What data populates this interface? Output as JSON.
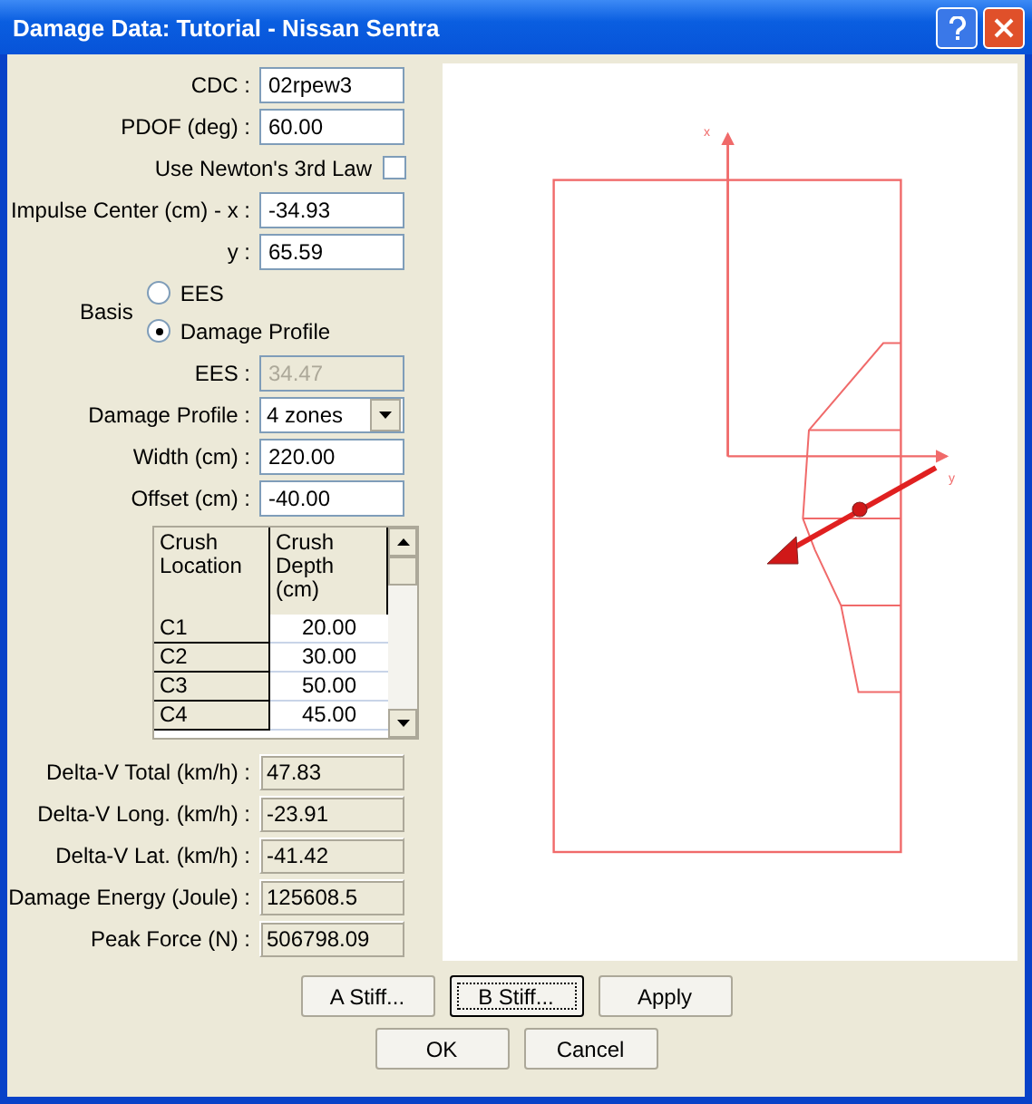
{
  "window": {
    "title": "Damage Data: Tutorial - Nissan Sentra"
  },
  "fields": [
    {
      "kind": "input",
      "label": "CDC :",
      "value": "02rpew3",
      "disabled": false
    },
    {
      "kind": "input",
      "label": "PDOF (deg) :",
      "value": "60.00",
      "disabled": false
    },
    {
      "kind": "checkbox",
      "label": "Use Newton's 3rd Law",
      "checked": false
    },
    {
      "kind": "input",
      "label": "Impulse Center (cm) - x :",
      "value": "-34.93",
      "disabled": false
    },
    {
      "kind": "input",
      "label": "y :",
      "value": "65.59",
      "disabled": false
    },
    {
      "kind": "radio",
      "label": "Basis",
      "options": [
        {
          "label": "EES",
          "selected": false
        },
        {
          "label": "Damage Profile",
          "selected": true
        }
      ]
    },
    {
      "kind": "input",
      "label": "EES :",
      "value": "34.47",
      "disabled": true
    },
    {
      "kind": "dropdown",
      "label": "Damage Profile :",
      "value": "4 zones"
    },
    {
      "kind": "input",
      "label": "Width (cm) :",
      "value": "220.00",
      "disabled": false
    },
    {
      "kind": "input",
      "label": "Offset (cm) :",
      "value": "-40.00",
      "disabled": false
    },
    {
      "kind": "table",
      "columns": [
        "Crush Location",
        "Crush Depth (cm)"
      ],
      "rows": [
        [
          "C1",
          "20.00"
        ],
        [
          "C2",
          "30.00"
        ],
        [
          "C3",
          "50.00"
        ],
        [
          "C4",
          "45.00"
        ]
      ]
    },
    {
      "kind": "output",
      "label": "Delta-V Total (km/h) :",
      "value": "47.83"
    },
    {
      "kind": "output",
      "label": "Delta-V Long. (km/h) :",
      "value": "-23.91"
    },
    {
      "kind": "output",
      "label": "Delta-V Lat. (km/h) :",
      "value": "-41.42"
    },
    {
      "kind": "output",
      "label": "Damage Energy (Joule) :",
      "value": "125608.5"
    },
    {
      "kind": "output",
      "label": "Peak Force (N) :",
      "value": "506798.09"
    }
  ],
  "diagram": {
    "x_axis_label": "x",
    "y_axis_label": "y"
  },
  "button_rows": [
    [
      {
        "label": "A Stiff...",
        "focused": false
      },
      {
        "label": "B Stiff...",
        "focused": true
      },
      {
        "label": "Apply",
        "focused": false
      }
    ],
    [
      {
        "label": "OK",
        "focused": false
      },
      {
        "label": "Cancel",
        "focused": false
      }
    ]
  ]
}
